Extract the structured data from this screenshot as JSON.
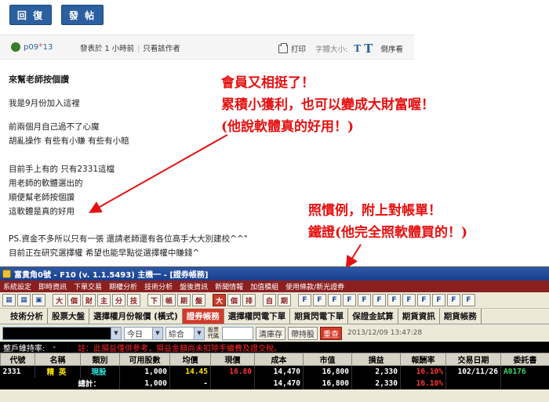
{
  "forum": {
    "reply_label": "回 復",
    "post_label": "發 帖",
    "username_prefix": "p09",
    "username_mark": "*",
    "username_suffix": "13",
    "posted_time": "發表於 1 小時前",
    "author_only": "只看該作者",
    "print_label": "打印",
    "font_size_label": "字體大小:",
    "font_small": "T",
    "font_large": "T",
    "reverse_label": "倒序看"
  },
  "post": {
    "title": "來幫老師按個讚",
    "lines": [
      "我是9月份加入這裡",
      "前兩個月自己過不了心魔",
      "胡亂操作 有些有小賺 有些有小賠",
      "目前手上有的 只有2331這檔",
      "用老師的軟體選出的",
      "順便幫老師按個讚",
      "這軟體是真的好用",
      "PS.資金不多所以只有一張  還請老師還有各位高手大大別建校^^\"",
      "目前正在研究選擇權  希望也能早點從選擇權中賺錢^"
    ]
  },
  "annotations": {
    "top": [
      "會員又相挺了！",
      "累積小獲利，也可以變成大財富喔！",
      "(他說軟體真的好用！)"
    ],
    "bottom": [
      "照慣例，附上對帳單！",
      "鐵證(他完全照軟體買的！)"
    ]
  },
  "app": {
    "title": "富貴角0號 - F10  (v. 1.1.5493) 主機一 - [證券帳務]",
    "menu": [
      "系統設定",
      "即時資訊",
      "下單交易",
      "期權分析",
      "技術分析",
      "盤後資訊",
      "新聞情報",
      "加值模組",
      "使用條款/新光證券"
    ],
    "icons": [
      "大",
      "個",
      "財",
      "主",
      "分",
      "技",
      "下",
      "帳",
      "期",
      "盤",
      "大",
      "個",
      "排",
      "自",
      "期",
      "F",
      "F",
      "F",
      "F",
      "F",
      "F",
      "F",
      "F",
      "F",
      "F",
      "F",
      "F"
    ],
    "tabs": [
      "技術分析",
      "股票大盤",
      "選擇權月份報價 (橫式)",
      "證券帳務",
      "選擇權閃電下單",
      "期貨閃電下單",
      "保證金試算",
      "期貨資訊",
      "期貨帳務"
    ],
    "active_tab_index": 3,
    "controls": {
      "period": "今日",
      "category": "綜合",
      "stock_code_label": "股票代碼",
      "clear_inventory": "清庫存",
      "special_stock": "帶持股",
      "query": "重查",
      "timestamp": "2013/12/09  13:47:28"
    },
    "status": {
      "rate_label": "整戶維持率:",
      "rate_value": "-",
      "warning": "註：此損益僅供參考，損益金額尚未扣除手續費及證交稅。"
    },
    "columns": [
      "代號",
      "名稱",
      "類別",
      "可用股數",
      "均價",
      "現價",
      "成本",
      "市值",
      "損益",
      "報酬率",
      "交易日期",
      "委託書"
    ],
    "rows": [
      [
        "2331",
        "精  英",
        "現股",
        "1,000",
        "14.45",
        "16.80",
        "14,470",
        "16,800",
        "2,330",
        "16.10%",
        "102/11/26",
        "A0176"
      ]
    ],
    "total": [
      "總計：",
      "1,000",
      "-",
      "14,470",
      "16,800",
      "2,330",
      "16.10%"
    ]
  }
}
